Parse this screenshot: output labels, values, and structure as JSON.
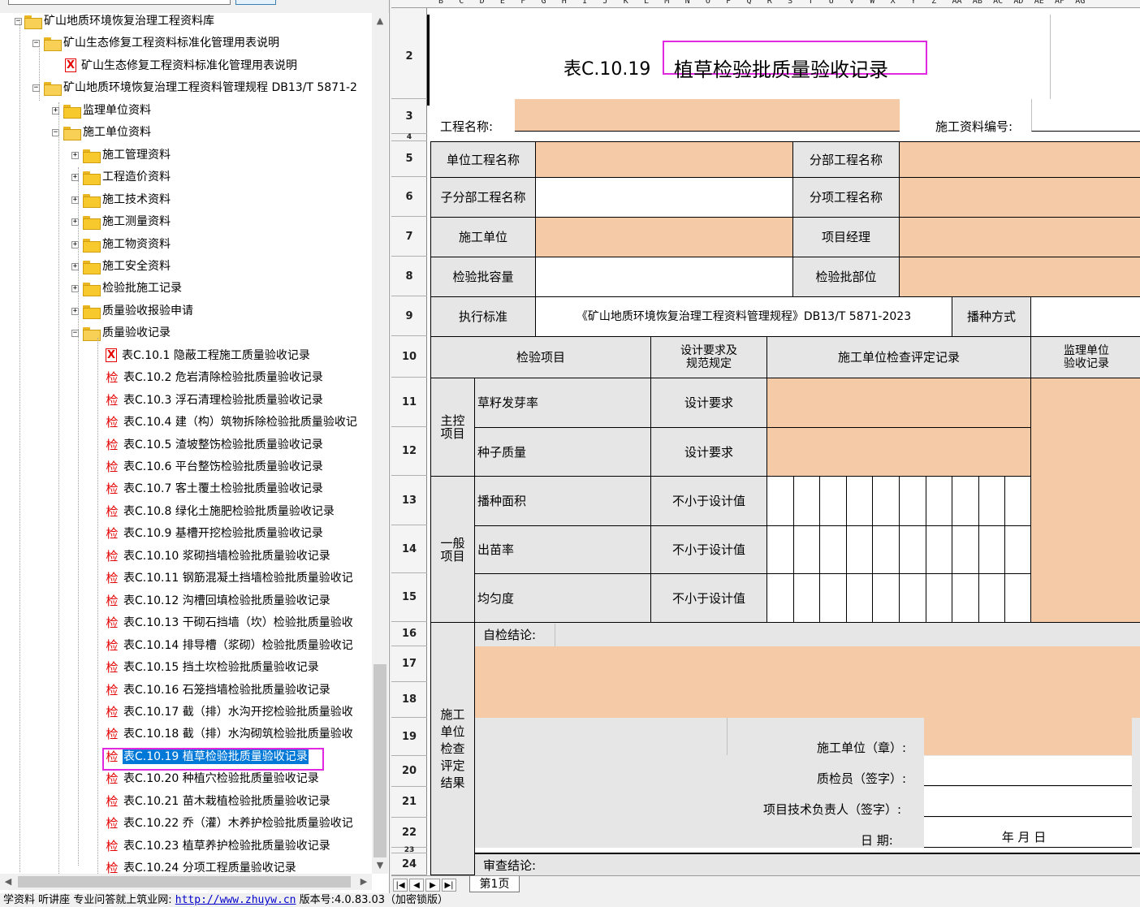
{
  "tree": {
    "items": [
      {
        "label": "矿山地质环境恢复治理工程资料库",
        "icon": "open-folder-icon",
        "toggle": "-",
        "level": 0
      },
      {
        "label": "矿山生态修复工程资料标准化管理用表说明",
        "icon": "open-folder-icon",
        "toggle": "-",
        "level": 1
      },
      {
        "label": "矿山生态修复工程资料标准化管理用表说明",
        "icon": "x-doc-icon",
        "toggle": "",
        "level": 2
      },
      {
        "label": "矿山地质环境恢复治理工程资料管理规程 DB13/T 5871-2",
        "icon": "open-folder-icon",
        "toggle": "-",
        "level": 1
      },
      {
        "label": "监理单位资料",
        "icon": "folder-icon",
        "toggle": "+",
        "level": 2
      },
      {
        "label": "施工单位资料",
        "icon": "open-folder-icon",
        "toggle": "-",
        "level": 2
      },
      {
        "label": "施工管理资料",
        "icon": "folder-icon",
        "toggle": "+",
        "level": 3
      },
      {
        "label": "工程造价资料",
        "icon": "folder-icon",
        "toggle": "+",
        "level": 3
      },
      {
        "label": "施工技术资料",
        "icon": "folder-icon",
        "toggle": "+",
        "level": 3
      },
      {
        "label": "施工测量资料",
        "icon": "folder-icon",
        "toggle": "+",
        "level": 3
      },
      {
        "label": "施工物资资料",
        "icon": "folder-icon",
        "toggle": "+",
        "level": 3
      },
      {
        "label": "施工安全资料",
        "icon": "folder-icon",
        "toggle": "+",
        "level": 3
      },
      {
        "label": "检验批施工记录",
        "icon": "folder-icon",
        "toggle": "+",
        "level": 3
      },
      {
        "label": "质量验收报验申请",
        "icon": "folder-icon",
        "toggle": "+",
        "level": 3
      },
      {
        "label": "质量验收记录",
        "icon": "open-folder-icon",
        "toggle": "-",
        "level": 3
      },
      {
        "label": "表C.10.1 隐蔽工程施工质量验收记录",
        "icon": "x-doc-icon",
        "toggle": "",
        "level": 4
      },
      {
        "label": "表C.10.2 危岩清除检验批质量验收记录",
        "icon": "jian-doc-icon",
        "toggle": "",
        "level": 4
      },
      {
        "label": "表C.10.3 浮石清理检验批质量验收记录",
        "icon": "jian-doc-icon",
        "toggle": "",
        "level": 4
      },
      {
        "label": "表C.10.4 建（构）筑物拆除检验批质量验收记",
        "icon": "jian-doc-icon",
        "toggle": "",
        "level": 4
      },
      {
        "label": "表C.10.5 渣坡整饬检验批质量验收记录",
        "icon": "jian-doc-icon",
        "toggle": "",
        "level": 4
      },
      {
        "label": "表C.10.6 平台整饬检验批质量验收记录",
        "icon": "jian-doc-icon",
        "toggle": "",
        "level": 4
      },
      {
        "label": "表C.10.7 客土覆土检验批质量验收记录",
        "icon": "jian-doc-icon",
        "toggle": "",
        "level": 4
      },
      {
        "label": "表C.10.8 绿化土施肥检验批质量验收记录",
        "icon": "jian-doc-icon",
        "toggle": "",
        "level": 4
      },
      {
        "label": "表C.10.9 基槽开挖检验批质量验收记录",
        "icon": "jian-doc-icon",
        "toggle": "",
        "level": 4
      },
      {
        "label": "表C.10.10 浆砌挡墙检验批质量验收记录",
        "icon": "jian-doc-icon",
        "toggle": "",
        "level": 4
      },
      {
        "label": "表C.10.11 钢筋混凝土挡墙检验批质量验收记",
        "icon": "jian-doc-icon",
        "toggle": "",
        "level": 4
      },
      {
        "label": "表C.10.12 沟槽回填检验批质量验收记录",
        "icon": "jian-doc-icon",
        "toggle": "",
        "level": 4
      },
      {
        "label": "表C.10.13 干砌石挡墙（坎）检验批质量验收",
        "icon": "jian-doc-icon",
        "toggle": "",
        "level": 4
      },
      {
        "label": "表C.10.14 排导槽（浆砌）检验批质量验收记",
        "icon": "jian-doc-icon",
        "toggle": "",
        "level": 4
      },
      {
        "label": "表C.10.15 挡土坎检验批质量验收记录",
        "icon": "jian-doc-icon",
        "toggle": "",
        "level": 4
      },
      {
        "label": "表C.10.16 石笼挡墙检验批质量验收记录",
        "icon": "jian-doc-icon",
        "toggle": "",
        "level": 4
      },
      {
        "label": "表C.10.17 截（排）水沟开挖检验批质量验收",
        "icon": "jian-doc-icon",
        "toggle": "",
        "level": 4
      },
      {
        "label": "表C.10.18 截（排）水沟砌筑检验批质量验收",
        "icon": "jian-doc-icon",
        "toggle": "",
        "level": 4
      },
      {
        "label": "表C.10.19 植草检验批质量验收记录",
        "icon": "jian-doc-icon",
        "toggle": "",
        "level": 4,
        "selected": true
      },
      {
        "label": "表C.10.20 种植穴检验批质量验收记录",
        "icon": "jian-doc-icon",
        "toggle": "",
        "level": 4
      },
      {
        "label": "表C.10.21 苗木栽植检验批质量验收记录",
        "icon": "jian-doc-icon",
        "toggle": "",
        "level": 4
      },
      {
        "label": "表C.10.22 乔（灌）木养护检验批质量验收记",
        "icon": "jian-doc-icon",
        "toggle": "",
        "level": 4
      },
      {
        "label": "表C.10.23 植草养护检验批质量验收记录",
        "icon": "jian-doc-icon",
        "toggle": "",
        "level": 4
      },
      {
        "label": "表C.10.24          分项工程质量验收记录",
        "icon": "jian-doc-icon",
        "toggle": "",
        "level": 4
      }
    ],
    "doc_glyph_jian": "检",
    "doc_glyph_x": "X"
  },
  "sheet": {
    "columns": [
      "B",
      "C",
      "D",
      "E",
      "F",
      "G",
      "H",
      "I",
      "J",
      "K",
      "L",
      "M",
      "N",
      "O",
      "P",
      "Q",
      "R",
      "S",
      "T",
      "U",
      "V",
      "W",
      "X",
      "Y",
      "Z",
      "AA",
      "AB",
      "AC",
      "AD",
      "AE",
      "AF",
      "AG"
    ],
    "rows": [
      "2",
      "3",
      "4",
      "5",
      "6",
      "7",
      "8",
      "9",
      "10",
      "11",
      "12",
      "13",
      "14",
      "15",
      "16",
      "17",
      "18",
      "19",
      "20",
      "21",
      "22",
      "23",
      "24"
    ],
    "title_prefix": "表C.10.19",
    "title_main": "植草检验批质量验收记录",
    "project_name_label": "工程名称:",
    "doc_no_label": "施工资料编号:",
    "unit_project_label": "单位工程名称",
    "division_project_label": "分部工程名称",
    "sub_division_label": "子分部工程名称",
    "sub_item_label": "分项工程名称",
    "contractor_label": "施工单位",
    "pm_label": "项目经理",
    "batch_capacity_label": "检验批容量",
    "batch_location_label": "检验批部位",
    "standard_label": "执行标准",
    "standard_value": "《矿山地质环境恢复治理工程资料管理规程》DB13/T 5871-2023",
    "sowing_method_label": "播种方式",
    "hdr_item": "检验项目",
    "hdr_design_1": "设计要求及",
    "hdr_design_2": "规范规定",
    "hdr_contractor_record": "施工单位检查评定记录",
    "hdr_supervisor_1": "监理单位",
    "hdr_supervisor_2": "验收记录",
    "main_ctrl_1": "主控",
    "main_ctrl_2": "项目",
    "general_1": "一般",
    "general_2": "项目",
    "item_germination": "草籽发芽率",
    "item_seed_quality": "种子质量",
    "item_sowing_area": "播种面积",
    "item_emergence": "出苗率",
    "item_uniformity": "均匀度",
    "req_design": "设计要求",
    "req_not_less": "不小于设计值",
    "self_check_label": "自检结论:",
    "eval_vertical": [
      "施工",
      "单位",
      "检查",
      "评定",
      "结果"
    ],
    "seal_label": "施工单位（章）:",
    "qc_label": "质检员（签字）:",
    "tech_lead_label": "项目技术负责人（签字）:",
    "date_label": "日    期:",
    "date_value": "年  月  日",
    "review_label": "审查结论:",
    "tab_name": "第1页"
  },
  "status_bar": {
    "prefix": "学资料  听讲座  专业问答就上筑业网:  ",
    "url": "http://www.zhuyw.cn",
    "version": "  版本号:4.0.83.03（加密锁版）"
  },
  "colors": {
    "highlight_box": "#e028e0",
    "selection": "#0078d7",
    "input_cell": "#f5cba7",
    "label_cell": "#e6e6e6"
  }
}
